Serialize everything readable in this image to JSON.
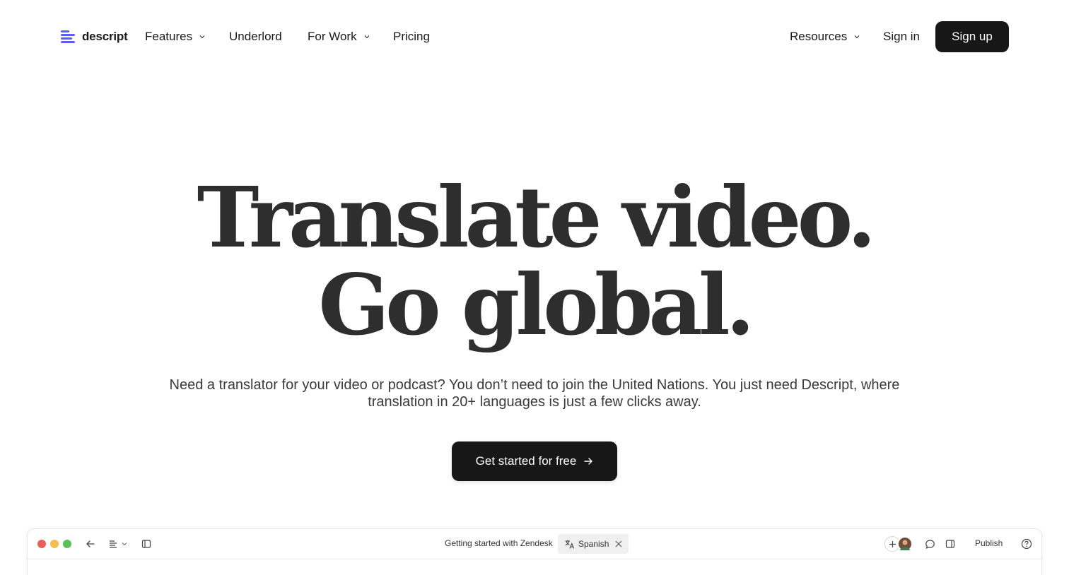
{
  "nav": {
    "logo_text": "descript",
    "brand_color": "#5b5bf5",
    "links": [
      {
        "label": "Features",
        "has_dropdown": true
      },
      {
        "label": "Underlord",
        "has_dropdown": false
      },
      {
        "label": "For Work",
        "has_dropdown": true
      },
      {
        "label": "Pricing",
        "has_dropdown": false
      }
    ],
    "resources": {
      "label": "Resources",
      "has_dropdown": true
    },
    "sign_in": "Sign in",
    "sign_up": "Sign up"
  },
  "hero": {
    "title_line1": "Translate video.",
    "title_line2": "Go global.",
    "subtitle": "Need a translator for your video or podcast? You don’t need to join the United Nations. You just need Descript, where translation in 20+ languages is just a few clicks away.",
    "cta_label": "Get started for free",
    "cta_icon": "arrow-right-icon"
  },
  "app_preview": {
    "project_title": "Getting started with Zendesk",
    "language_chip": "Spanish",
    "publish_label": "Publish",
    "window_dots": [
      "#ee5f57",
      "#f5be4f",
      "#58c354"
    ]
  }
}
